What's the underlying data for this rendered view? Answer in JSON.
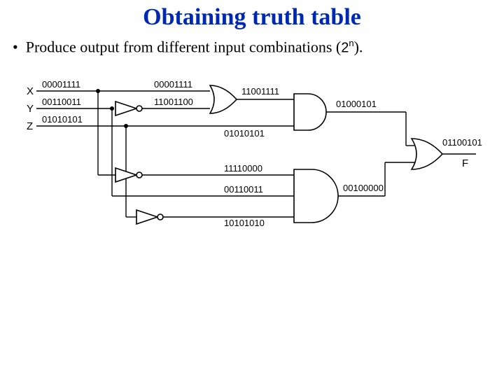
{
  "title": "Obtaining truth table",
  "bullet_prefix": "Produce output from different input combinations (",
  "bullet_two": "2",
  "bullet_n": "n",
  "bullet_suffix": ").",
  "inputs": {
    "x": "X",
    "y": "Y",
    "z": "Z"
  },
  "signals": {
    "x_bits": "00001111",
    "y_bits": "00110011",
    "z_bits": "01010101",
    "x_rep": "00001111",
    "not_y": "11001100",
    "or1_out": "11001111",
    "z_rep": "01010101",
    "and1_out": "01000101",
    "not_x": "11110000",
    "y_rep": "00110011",
    "not_z": "10101010",
    "and2_out": "00100000",
    "f_out": "01100101",
    "f_label": "F"
  }
}
